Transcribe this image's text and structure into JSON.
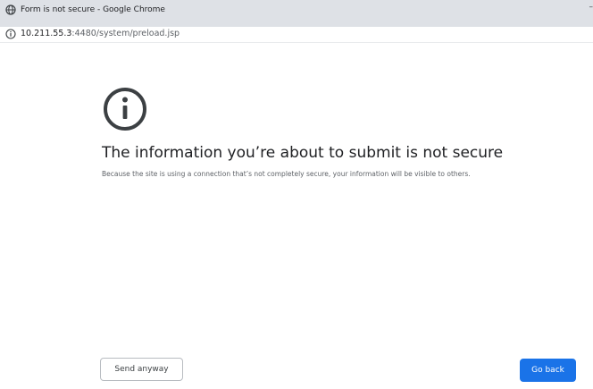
{
  "window": {
    "title": "Form is not secure - Google Chrome",
    "controls": "–"
  },
  "address_bar": {
    "icon": "info-icon",
    "url_host": "10.211.55.3",
    "url_path": ":4480/system/preload.jsp"
  },
  "interstitial": {
    "icon": "info-icon",
    "heading": "The information you’re about to submit is not secure",
    "description": "Because the site is using a connection that’s not completely secure, your information will be visible to others."
  },
  "buttons": {
    "send_anyway": "Send anyway",
    "go_back": "Go back"
  },
  "colors": {
    "primary_button": "#1a73e8",
    "titlebar": "#dee1e6"
  }
}
